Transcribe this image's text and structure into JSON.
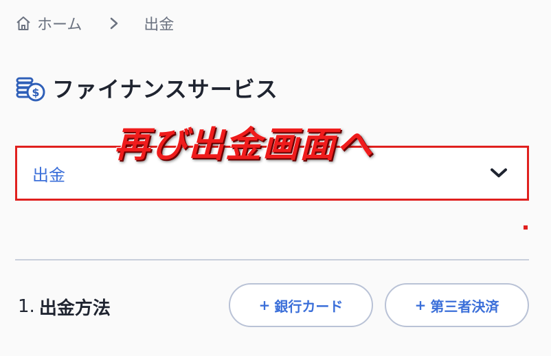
{
  "breadcrumb": {
    "home_label": "ホーム",
    "current_label": "出金"
  },
  "section": {
    "title": "ファイナンスサービス"
  },
  "dropdown": {
    "selected_value": "出金"
  },
  "annotation": {
    "text": "再び出金画面へ"
  },
  "method": {
    "step_number": "1.",
    "label": "出金方法",
    "options": [
      {
        "plus": "+",
        "label": "銀行カード"
      },
      {
        "plus": "+",
        "label": "第三者決済"
      }
    ]
  },
  "colors": {
    "accent_blue": "#3b6fd9",
    "highlight_red": "#e0201e",
    "text_dark": "#1f2430",
    "muted_gray": "#6b7280"
  }
}
